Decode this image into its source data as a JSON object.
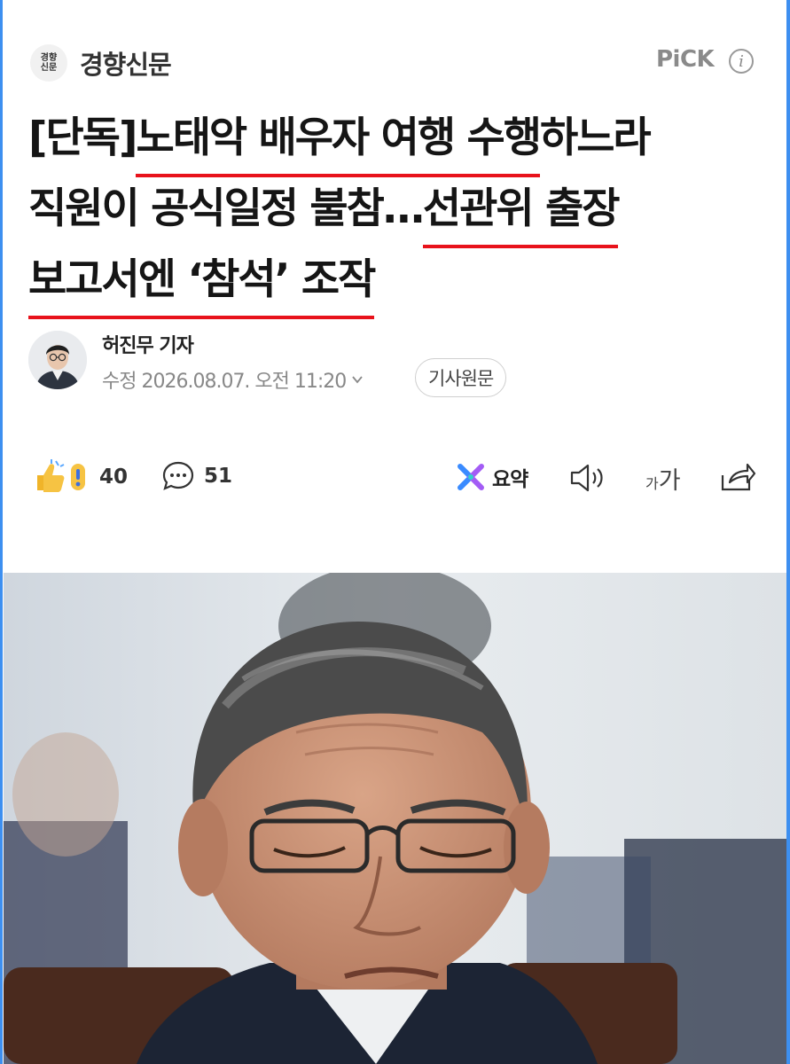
{
  "press": {
    "logo_line1": "경향",
    "logo_line2": "신문",
    "name": "경향신문"
  },
  "pick_label": "PiCK",
  "headline": {
    "l1_a": "[단독]",
    "l1_b": "노태악 배우자 여행 수행",
    "l1_c": "하느라",
    "l2_a": "직원이 공식일정 불참…",
    "l2_b": "선관위 출장",
    "l3_a": "보고서엔 ‘참석’ 조작"
  },
  "author": {
    "name": "허진무 기자",
    "edited": "수정 2026.08.07. 오전 11:20"
  },
  "original_button": "기사원문",
  "actions": {
    "reaction_count": "40",
    "comment_count": "51",
    "summary_label": "요약",
    "font_small": "가",
    "font_big": "가"
  },
  "colors": {
    "underline": "#e8121b",
    "frame": "#3d8ff0"
  }
}
